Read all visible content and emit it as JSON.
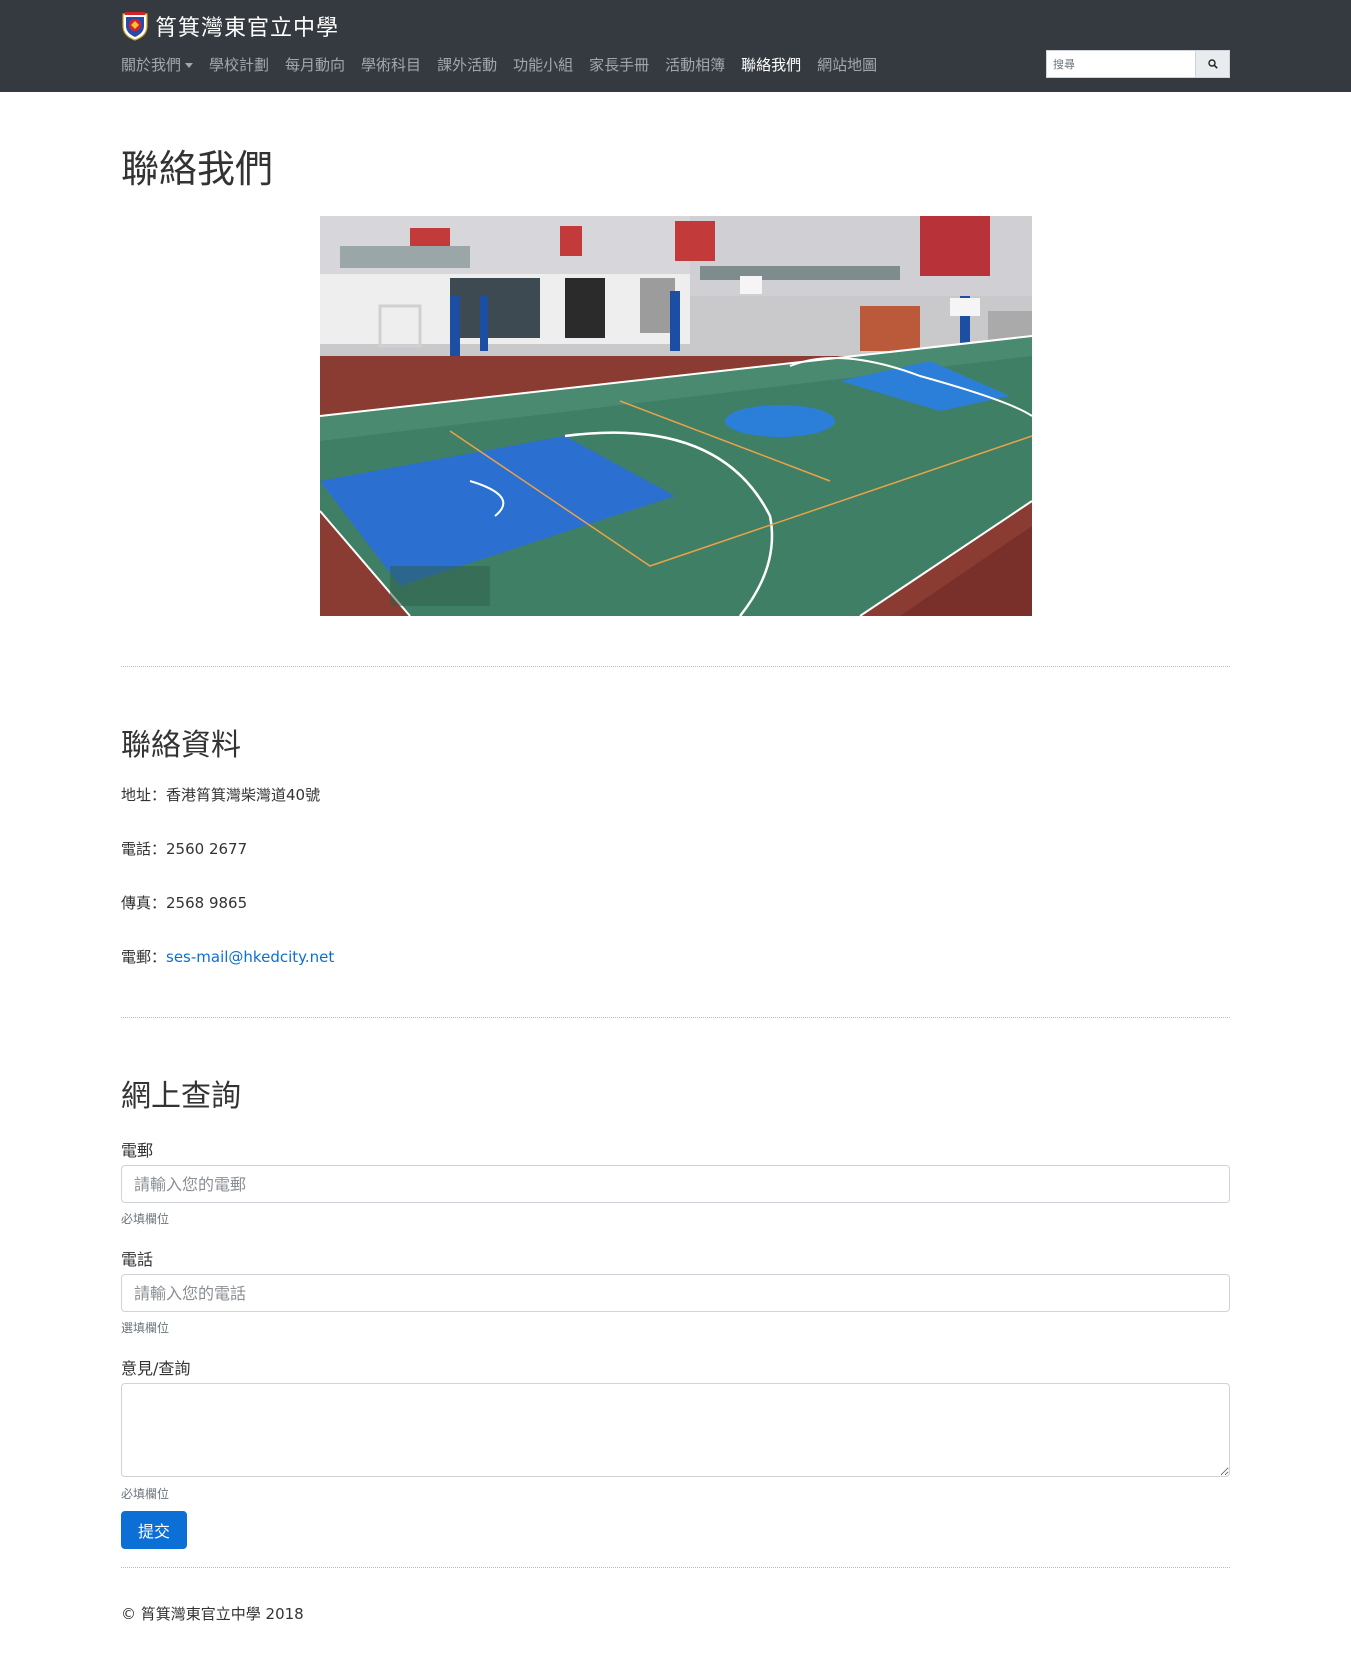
{
  "navbar": {
    "brand": "筲箕灣東官立中學",
    "logo_icon": "school-crest-icon",
    "items": [
      {
        "label": "關於我們",
        "dropdown": true
      },
      {
        "label": "學校計劃"
      },
      {
        "label": "每月動向"
      },
      {
        "label": "學術科目"
      },
      {
        "label": "課外活動"
      },
      {
        "label": "功能小組"
      },
      {
        "label": "家長手冊"
      },
      {
        "label": "活動相簿"
      },
      {
        "label": "聯絡我們",
        "active": true
      },
      {
        "label": "網站地圖"
      }
    ],
    "search": {
      "placeholder": "搜尋",
      "icon": "search-icon"
    }
  },
  "page": {
    "title": "聯絡我們",
    "hero_image": "basketball-court-photo"
  },
  "contact": {
    "title": "聯絡資料",
    "address_label": "地址：",
    "address": "香港筲箕灣柴灣道40號",
    "phone_label": "電話：",
    "phone": "2560 2677",
    "fax_label": "傳真：",
    "fax": "2568 9865",
    "email_label": "電郵：",
    "email": "ses-mail@hkedcity.net"
  },
  "inquiry": {
    "title": "網上查詢",
    "email_label": "電郵",
    "email_placeholder": "請輸入您的電郵",
    "email_help": "必填欄位",
    "phone_label": "電話",
    "phone_placeholder": "請輸入您的電話",
    "phone_help": "選填欄位",
    "message_label": "意見/查詢",
    "message_help": "必填欄位",
    "submit": "提交"
  },
  "footer": {
    "text": "© 筲箕灣東官立中學 2018"
  },
  "colors": {
    "navbar_bg": "#343a40",
    "link": "#0b6fd6",
    "primary_button": "#0b6fd6"
  }
}
